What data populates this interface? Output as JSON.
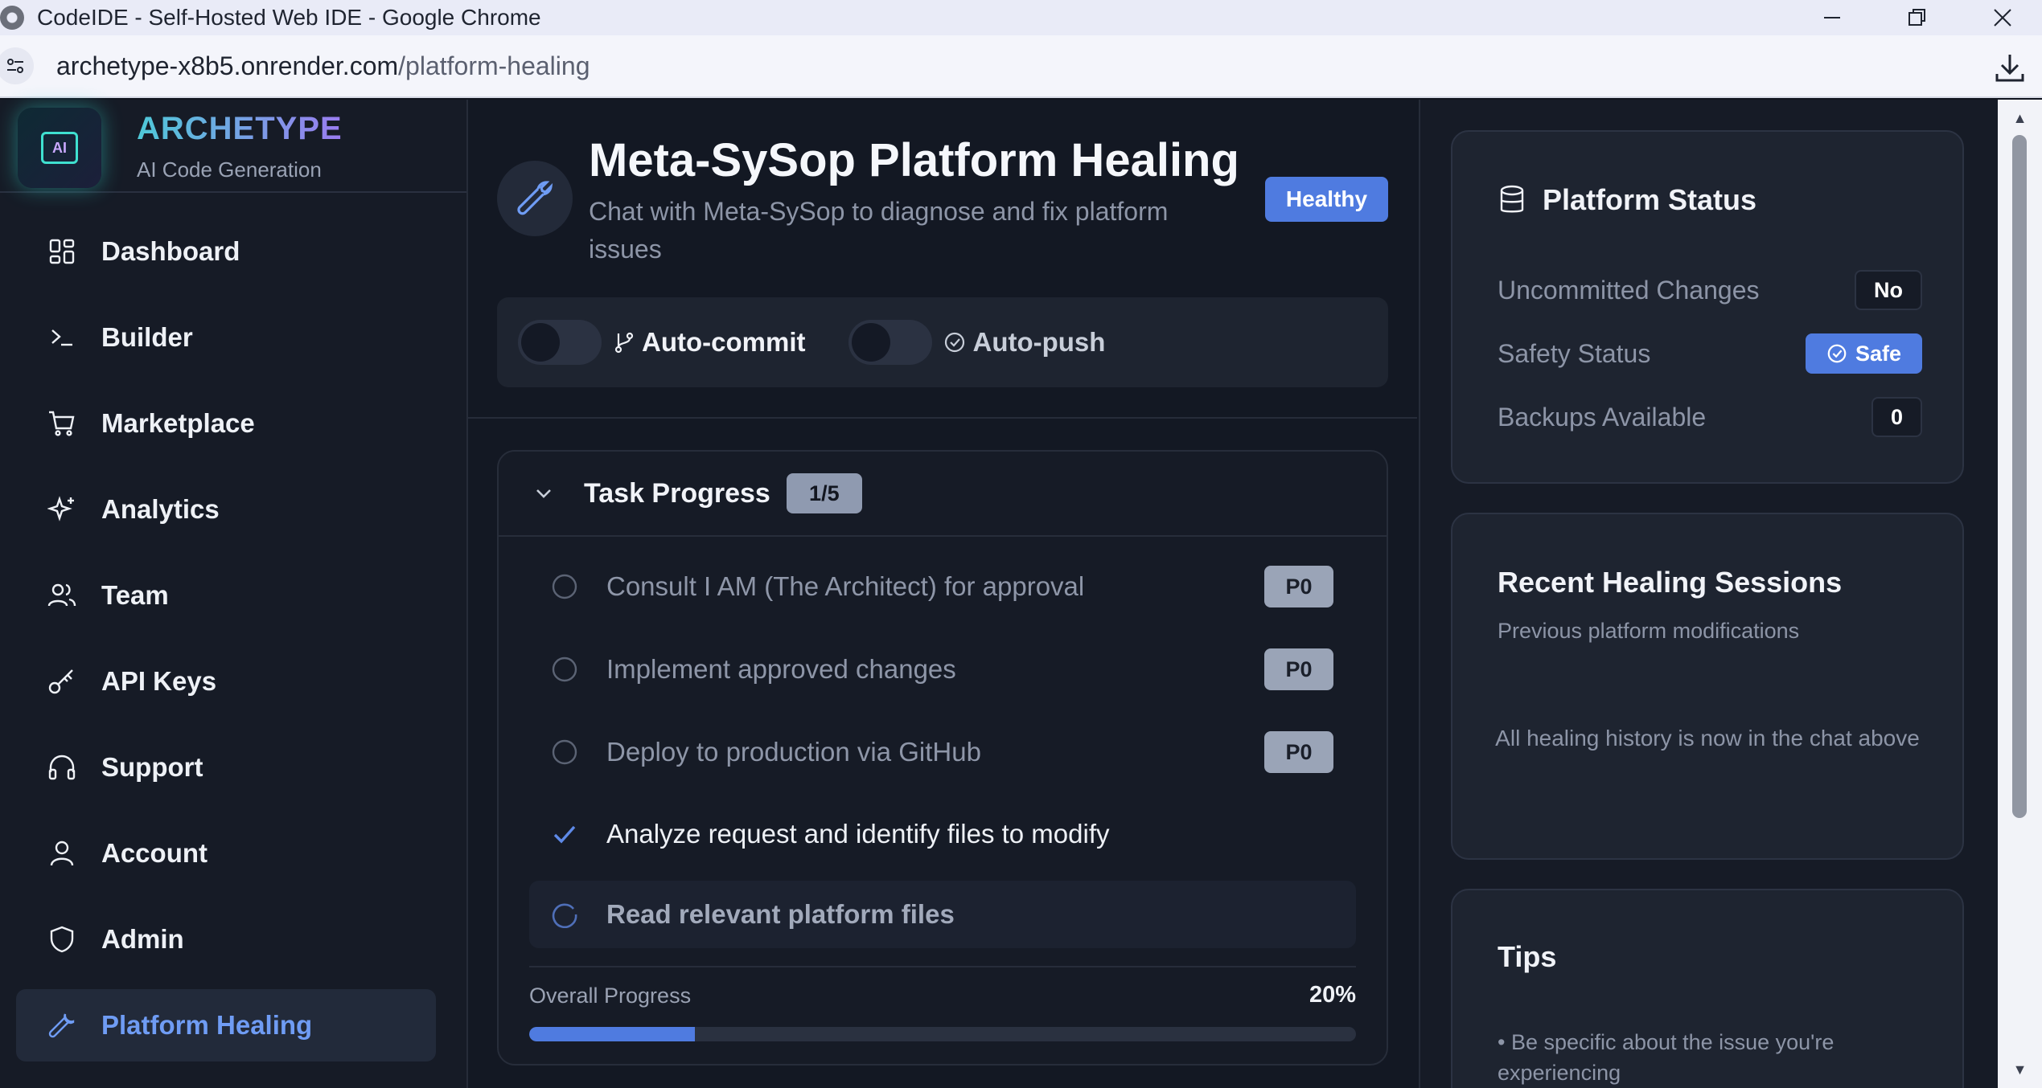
{
  "browser": {
    "window_title": "CodeIDE - Self-Hosted Web IDE - Google Chrome",
    "url_host": "archetype-x8b5.onrender.com",
    "url_path": "/platform-healing"
  },
  "brand": {
    "name": "ARCHETYPE",
    "tagline": "AI Code Generation",
    "logo_text": "AI"
  },
  "sidebar": {
    "items": [
      {
        "label": "Dashboard",
        "icon": "dashboard-icon"
      },
      {
        "label": "Builder",
        "icon": "terminal-icon"
      },
      {
        "label": "Marketplace",
        "icon": "cart-icon"
      },
      {
        "label": "Analytics",
        "icon": "sparkles-icon"
      },
      {
        "label": "Team",
        "icon": "users-icon"
      },
      {
        "label": "API Keys",
        "icon": "key-icon"
      },
      {
        "label": "Support",
        "icon": "headphones-icon"
      },
      {
        "label": "Account",
        "icon": "user-icon"
      },
      {
        "label": "Admin",
        "icon": "shield-icon"
      },
      {
        "label": "Platform Healing",
        "icon": "wrench-icon",
        "active": true
      }
    ]
  },
  "header": {
    "title": "Meta-SySop Platform Healing",
    "subtitle": "Chat with Meta-SySop to diagnose and fix platform issues",
    "status_badge": "Healthy"
  },
  "toggles": {
    "auto_commit": {
      "label": "Auto-commit",
      "on": false
    },
    "auto_push": {
      "label": "Auto-push",
      "on": false
    }
  },
  "task_progress": {
    "title": "Task Progress",
    "count": "1/5",
    "tasks": [
      {
        "text": "Consult I AM (The Architect) for approval",
        "priority": "P0",
        "status": "pending"
      },
      {
        "text": "Implement approved changes",
        "priority": "P0",
        "status": "pending"
      },
      {
        "text": "Deploy to production via GitHub",
        "priority": "P0",
        "status": "pending"
      },
      {
        "text": "Analyze request and identify files to modify",
        "status": "done"
      },
      {
        "text": "Read relevant platform files",
        "status": "in-progress"
      }
    ],
    "overall_label": "Overall Progress",
    "overall_percent": "20%",
    "overall_fraction": 0.2
  },
  "platform_status": {
    "title": "Platform Status",
    "rows": [
      {
        "label": "Uncommitted Changes",
        "value": "No"
      },
      {
        "label": "Safety Status",
        "value": "Safe"
      },
      {
        "label": "Backups Available",
        "value": "0"
      }
    ]
  },
  "recent_sessions": {
    "title": "Recent Healing Sessions",
    "subtitle": "Previous platform modifications",
    "note": "All healing history is now in the chat above"
  },
  "tips": {
    "title": "Tips",
    "items": [
      "• Be specific about the issue you're experiencing"
    ]
  },
  "colors": {
    "accent": "#4f7be0",
    "active_nav_text": "#6f9cf4",
    "background": "#131823"
  }
}
